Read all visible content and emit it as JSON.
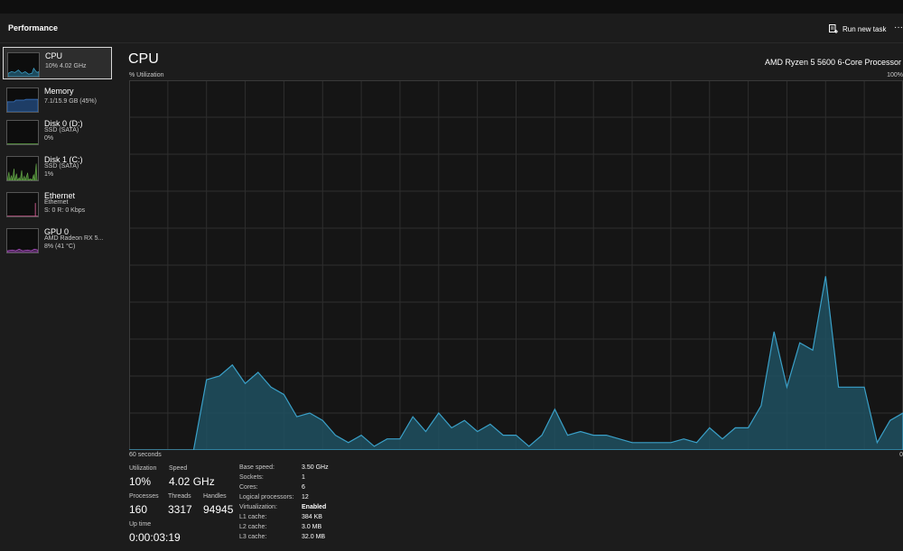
{
  "header": {
    "title": "Performance",
    "run_new_task": "Run new task",
    "more": "···"
  },
  "sidebar": {
    "items": [
      {
        "name": "CPU",
        "line1": "10% 4.02 GHz",
        "line2": "",
        "color": "#3aa0c8"
      },
      {
        "name": "Memory",
        "line1": "7.1/15.9 GB (45%)",
        "line2": "",
        "color": "#3a78c8"
      },
      {
        "name": "Disk 0 (D:)",
        "line1": "SSD (SATA)",
        "line2": "0%",
        "color": "#6ab04c"
      },
      {
        "name": "Disk 1 (C:)",
        "line1": "SSD (SATA)",
        "line2": "1%",
        "color": "#6ab04c"
      },
      {
        "name": "Ethernet",
        "line1": "Ethernet",
        "line2": "S: 0 R: 0 Kbps",
        "color": "#c85a8c"
      },
      {
        "name": "GPU 0",
        "line1": "AMD Radeon RX 5...",
        "line2": "8% (41 °C)",
        "color": "#b04cc8"
      }
    ]
  },
  "main": {
    "title": "CPU",
    "processor": "AMD Ryzen 5 5600 6-Core Processor",
    "y_axis_label": "% Utilization",
    "y_max_label": "100%",
    "x_left_label": "60 seconds",
    "x_right_label": "0"
  },
  "stats": {
    "utilization_label": "Utilization",
    "utilization": "10%",
    "speed_label": "Speed",
    "speed": "4.02 GHz",
    "processes_label": "Processes",
    "processes": "160",
    "threads_label": "Threads",
    "threads": "3317",
    "handles_label": "Handles",
    "handles": "94945",
    "uptime_label": "Up time",
    "uptime": "0:00:03:19"
  },
  "specs": [
    {
      "label": "Base speed:",
      "value": "3.50 GHz"
    },
    {
      "label": "Sockets:",
      "value": "1"
    },
    {
      "label": "Cores:",
      "value": "6"
    },
    {
      "label": "Logical processors:",
      "value": "12"
    },
    {
      "label": "Virtualization:",
      "value": "Enabled"
    },
    {
      "label": "L1 cache:",
      "value": "384 KB"
    },
    {
      "label": "L2 cache:",
      "value": "3.0 MB"
    },
    {
      "label": "L3 cache:",
      "value": "32.0 MB"
    }
  ],
  "chart_data": {
    "type": "area",
    "xlabel": "60 seconds",
    "ylabel": "% Utilization",
    "xlim": [
      60,
      0
    ],
    "ylim": [
      0,
      100
    ],
    "grid": true,
    "color": "#3aa0c8",
    "x": [
      60,
      59,
      58,
      57,
      56,
      55,
      54,
      53,
      52,
      51,
      50,
      49,
      48,
      47,
      46,
      45,
      44,
      43,
      42,
      41,
      40,
      39,
      38,
      37,
      36,
      35,
      34,
      33,
      32,
      31,
      30,
      29,
      28,
      27,
      26,
      25,
      24,
      23,
      22,
      21,
      20,
      19,
      18,
      17,
      16,
      15,
      14,
      13,
      12,
      11,
      10,
      9,
      8,
      7,
      6,
      5,
      4,
      3,
      2,
      1,
      0
    ],
    "series": [
      {
        "values": [
          0,
          0,
          0,
          0,
          0,
          0,
          19,
          20,
          23,
          18,
          21,
          17,
          15,
          9,
          10,
          8,
          4,
          2,
          4,
          1,
          3,
          3,
          9,
          5,
          10,
          6,
          8,
          5,
          7,
          4,
          4,
          1,
          4,
          11,
          4,
          5,
          4,
          4,
          3,
          2,
          2,
          2,
          2,
          3,
          2,
          6,
          3,
          6,
          6,
          12,
          32,
          17,
          29,
          27,
          47,
          17,
          17,
          17,
          2,
          8,
          10
        ]
      }
    ]
  }
}
